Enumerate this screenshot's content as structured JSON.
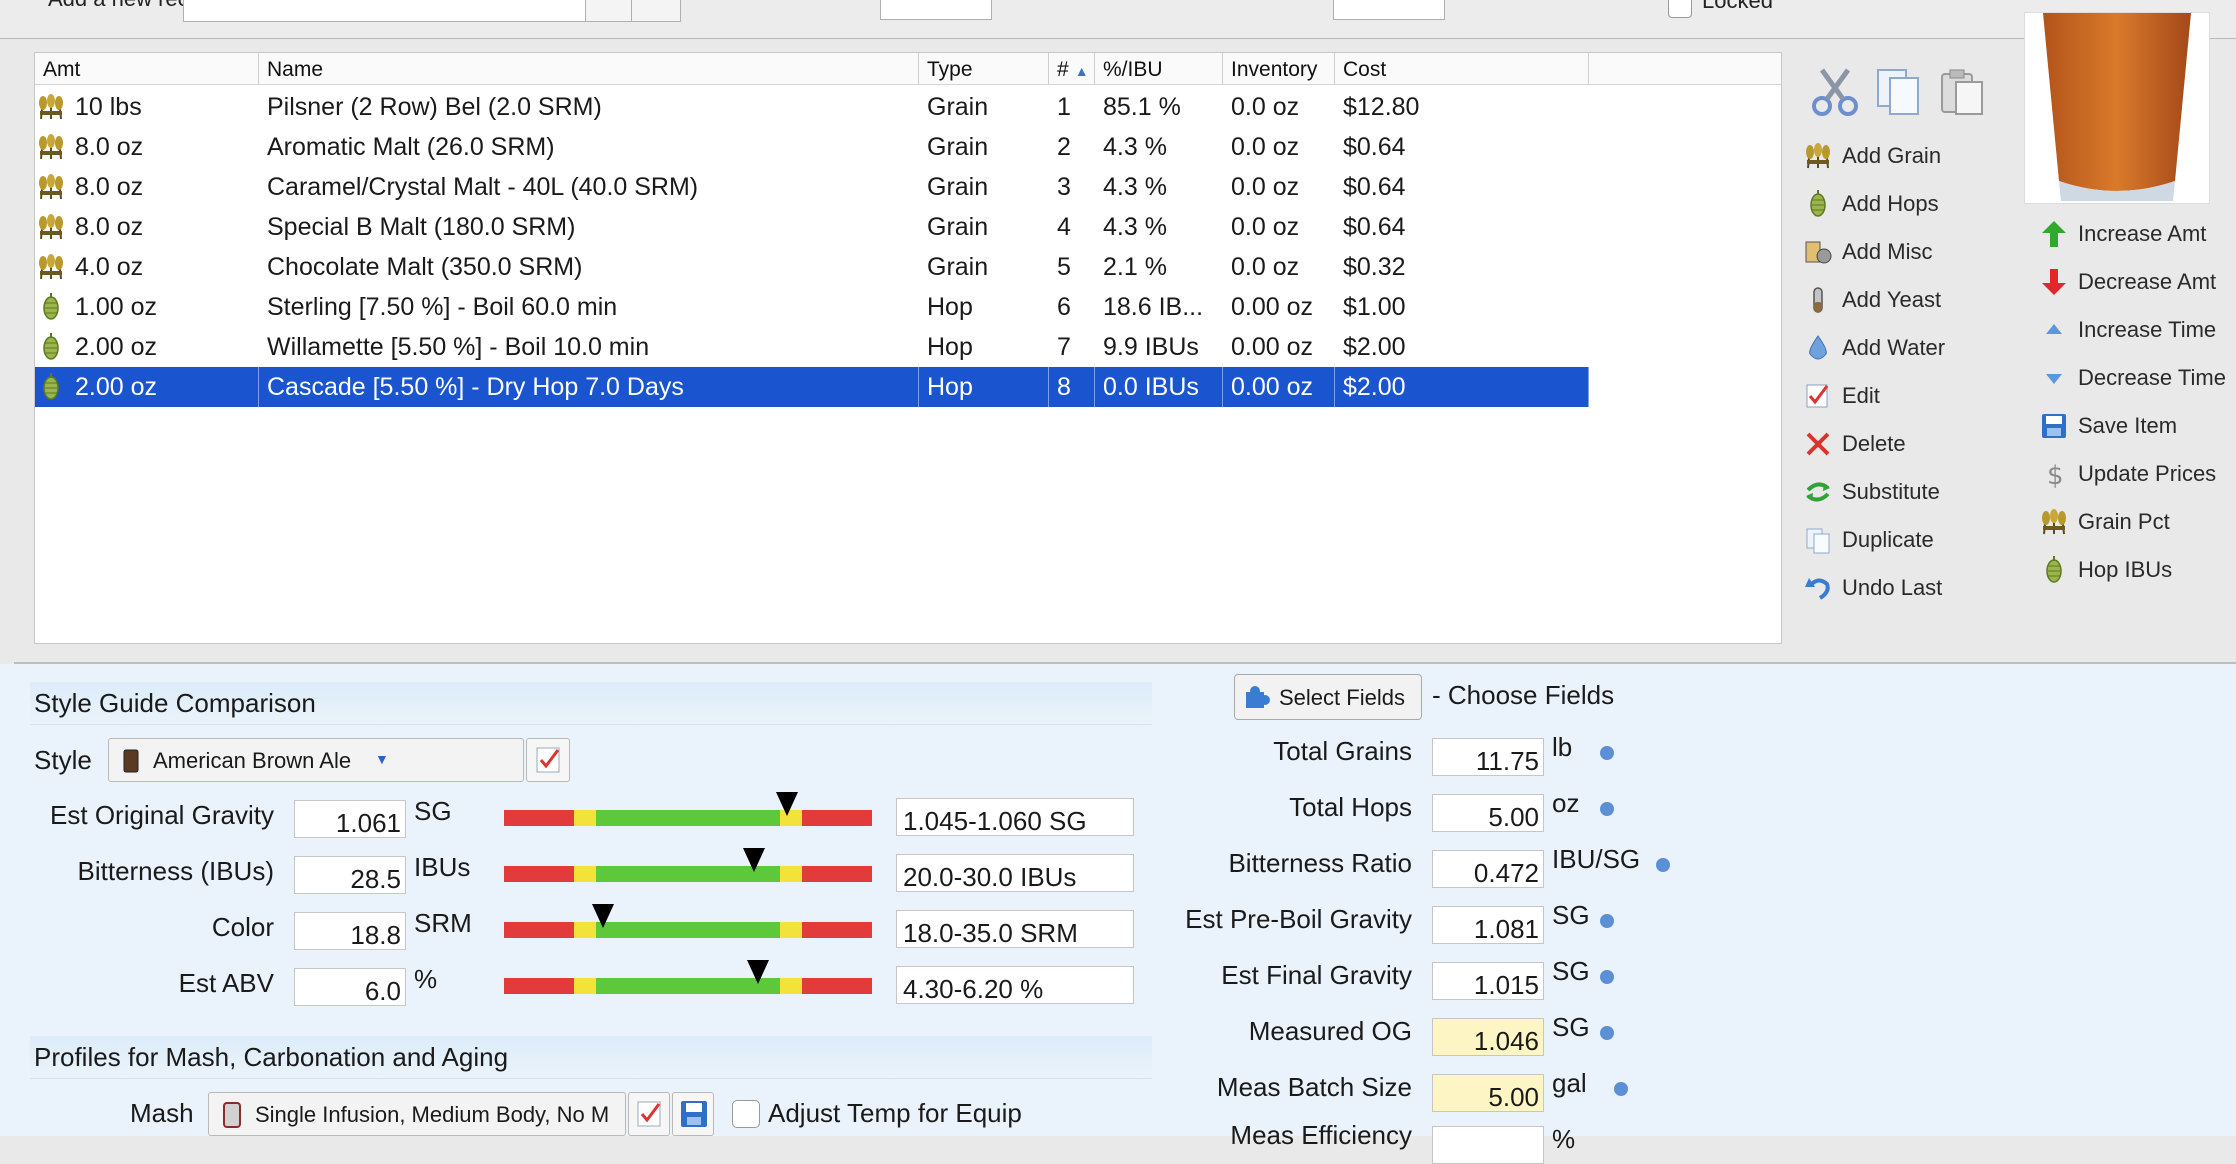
{
  "top": {
    "new_recipe_label": "Add a new recipe",
    "locked_label": "Locked"
  },
  "table": {
    "headers": {
      "amt": "Amt",
      "name": "Name",
      "type": "Type",
      "num": "#",
      "pct_ibu": "%/IBU",
      "inventory": "Inventory",
      "cost": "Cost"
    },
    "rows": [
      {
        "icon": "grain-icon",
        "amt": "10 lbs",
        "name": "Pilsner (2 Row) Bel (2.0 SRM)",
        "type": "Grain",
        "num": "1",
        "pct": "85.1 %",
        "inv": "0.0 oz",
        "cost": "$12.80"
      },
      {
        "icon": "grain-icon",
        "amt": "8.0 oz",
        "name": "Aromatic Malt (26.0 SRM)",
        "type": "Grain",
        "num": "2",
        "pct": "4.3 %",
        "inv": "0.0 oz",
        "cost": "$0.64"
      },
      {
        "icon": "grain-icon",
        "amt": "8.0 oz",
        "name": "Caramel/Crystal Malt - 40L (40.0 SRM)",
        "type": "Grain",
        "num": "3",
        "pct": "4.3 %",
        "inv": "0.0 oz",
        "cost": "$0.64"
      },
      {
        "icon": "grain-icon",
        "amt": "8.0 oz",
        "name": "Special B Malt (180.0 SRM)",
        "type": "Grain",
        "num": "4",
        "pct": "4.3 %",
        "inv": "0.0 oz",
        "cost": "$0.64"
      },
      {
        "icon": "grain-icon",
        "amt": "4.0 oz",
        "name": "Chocolate Malt (350.0 SRM)",
        "type": "Grain",
        "num": "5",
        "pct": "2.1 %",
        "inv": "0.0 oz",
        "cost": "$0.32"
      },
      {
        "icon": "hop-icon",
        "amt": "1.00 oz",
        "name": "Sterling [7.50 %] - Boil 60.0 min",
        "type": "Hop",
        "num": "6",
        "pct": "18.6 IB...",
        "inv": "0.00 oz",
        "cost": "$1.00"
      },
      {
        "icon": "hop-icon",
        "amt": "2.00 oz",
        "name": "Willamette [5.50 %] - Boil 10.0 min",
        "type": "Hop",
        "num": "7",
        "pct": "9.9 IBUs",
        "inv": "0.00 oz",
        "cost": "$2.00"
      },
      {
        "icon": "hop-icon",
        "amt": "2.00 oz",
        "name": "Cascade [5.50 %] - Dry Hop 7.0 Days",
        "type": "Hop",
        "num": "8",
        "pct": "0.0 IBUs",
        "inv": "0.00 oz",
        "cost": "$2.00"
      }
    ]
  },
  "actions_left": [
    {
      "label": "Add Grain",
      "icon": "grain-icon"
    },
    {
      "label": "Add Hops",
      "icon": "hop-icon"
    },
    {
      "label": "Add Misc",
      "icon": "misc-icon"
    },
    {
      "label": "Add Yeast",
      "icon": "yeast-icon"
    },
    {
      "label": "Add Water",
      "icon": "water-drop-icon"
    },
    {
      "label": "Edit",
      "icon": "edit-icon"
    },
    {
      "label": "Delete",
      "icon": "delete-x-icon"
    },
    {
      "label": "Substitute",
      "icon": "substitute-icon"
    },
    {
      "label": "Duplicate",
      "icon": "duplicate-icon"
    },
    {
      "label": "Undo Last",
      "icon": "undo-icon"
    }
  ],
  "actions_right": [
    {
      "label": "Increase Amt",
      "icon": "up-arrow-icon"
    },
    {
      "label": "Decrease Amt",
      "icon": "down-arrow-icon"
    },
    {
      "label": "Increase Time",
      "icon": "small-up-triangle-icon"
    },
    {
      "label": "Decrease Time",
      "icon": "small-down-triangle-icon"
    },
    {
      "label": "Save Item",
      "icon": "save-icon"
    },
    {
      "label": "Update Prices",
      "icon": "dollar-icon"
    },
    {
      "label": "Grain Pct",
      "icon": "grain-icon"
    },
    {
      "label": "Hop IBUs",
      "icon": "hop-icon"
    }
  ],
  "style_guide": {
    "title": "Style Guide Comparison",
    "style_label": "Style",
    "style_value": "American Brown Ale",
    "rows": [
      {
        "label": "Est Original Gravity",
        "value": "1.061",
        "unit": "SG",
        "range": "1.045-1.060 SG",
        "marker_fraction": 0.77
      },
      {
        "label": "Bitterness (IBUs)",
        "value": "28.5",
        "unit": "IBUs",
        "range": "20.0-30.0 IBUs",
        "marker_fraction": 0.68
      },
      {
        "label": "Color",
        "value": "18.8",
        "unit": "SRM",
        "range": "18.0-35.0 SRM",
        "marker_fraction": 0.27
      },
      {
        "label": "Est ABV",
        "value": "6.0",
        "unit": "%",
        "range": "4.30-6.20 %",
        "marker_fraction": 0.69
      }
    ]
  },
  "profiles": {
    "title": "Profiles for Mash, Carbonation and Aging",
    "mash_label": "Mash",
    "mash_value": "Single Infusion, Medium Body, No M",
    "adjust_label": "Adjust Temp for Equip"
  },
  "fields": {
    "select_button": "Select Fields",
    "choose_label": "- Choose Fields",
    "rows": [
      {
        "label": "Total Grains",
        "value": "11.75",
        "unit": "lb",
        "highlight": false
      },
      {
        "label": "Total Hops",
        "value": "5.00",
        "unit": "oz",
        "highlight": false
      },
      {
        "label": "Bitterness Ratio",
        "value": "0.472",
        "unit": "IBU/SG",
        "highlight": false
      },
      {
        "label": "Est Pre-Boil Gravity",
        "value": "1.081",
        "unit": "SG",
        "highlight": false
      },
      {
        "label": "Est Final Gravity",
        "value": "1.015",
        "unit": "SG",
        "highlight": false
      },
      {
        "label": "Measured OG",
        "value": "1.046",
        "unit": "SG",
        "highlight": true
      },
      {
        "label": "Meas Batch Size",
        "value": "5.00",
        "unit": "gal",
        "highlight": true
      }
    ],
    "partial_label": "Meas Efficiency",
    "partial_unit": "%"
  },
  "colors": {
    "selection": "#1a55cf",
    "bar_red": "#e23b3b",
    "bar_yellow": "#f2e23a",
    "bar_green": "#5cc83a",
    "highlight_yellow": "#fdf6c4",
    "panel_blue": "#eaf3fb"
  }
}
